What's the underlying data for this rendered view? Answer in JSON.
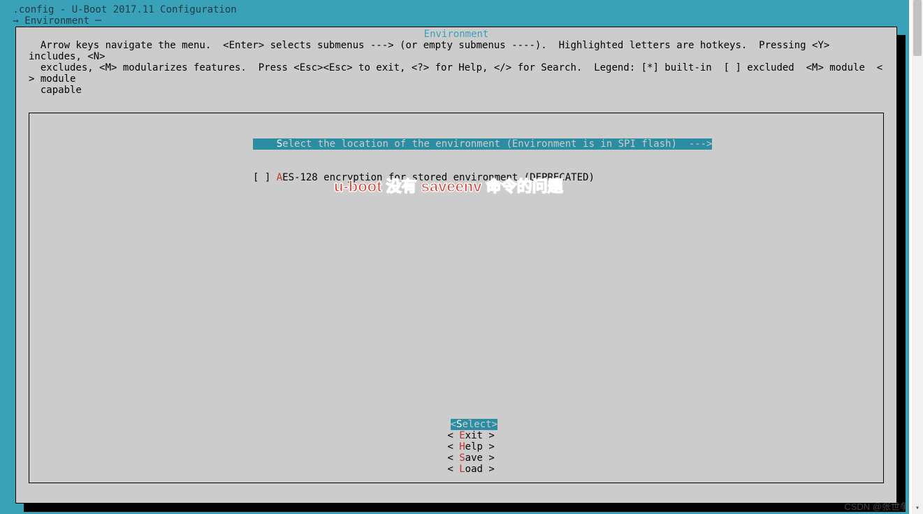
{
  "window": {
    "title": " .config - U-Boot 2017.11 Configuration",
    "breadcrumb": " → Environment ─"
  },
  "panel": {
    "title": "Environment",
    "help_lines": [
      "  Arrow keys navigate the menu.  <Enter> selects submenus ---> (or empty submenus ----).  Highlighted letters are hotkeys.  Pressing <Y> includes, <N>",
      "  excludes, <M> modularizes features.  Press <Esc><Esc> to exit, <?> for Help, </> for Search.  Legend: [*] built-in  [ ] excluded  <M> module  < > module",
      "  capable"
    ]
  },
  "menu": {
    "items": [
      {
        "prefix": "    ",
        "hotkey": "S",
        "rest": "elect the location of the environment (Environment is in SPI flash)  --->",
        "selected": true
      },
      {
        "prefix": "[ ] ",
        "hotkey": "A",
        "rest": "ES-128 encryption for stored environment (DEPRECATED)",
        "selected": false
      }
    ]
  },
  "annotation": "u-boot 没有 saveenv 命令的问题",
  "buttons": {
    "select": {
      "open": "<",
      "hk": "S",
      "rest": "elect>",
      "selected": true
    },
    "exit": {
      "open": "< ",
      "hk": "E",
      "rest": "xit > "
    },
    "help": {
      "open": "< ",
      "hk": "H",
      "rest": "elp > "
    },
    "save": {
      "open": "< ",
      "hk": "S",
      "rest": "ave > "
    },
    "load": {
      "open": "< ",
      "hk": "L",
      "rest": "oad > "
    }
  },
  "watermark": "CSDN @张世争"
}
